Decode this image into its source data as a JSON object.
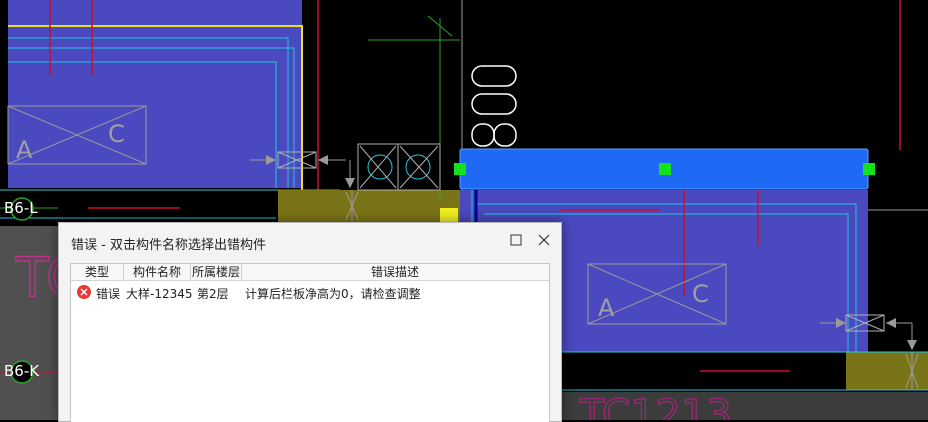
{
  "canvas": {
    "axis_labels": [
      "B6-L",
      "B6-K"
    ],
    "beam_text": [
      "A",
      "C"
    ],
    "colors": {
      "background": "#000000",
      "slab_fill": "#4a49c0",
      "selected_fill": "#1e6af5",
      "olive_fill": "#7a7418",
      "cyan_line": "#22c8dc",
      "red_line": "#c8102e",
      "grip": "#16e01a",
      "yellow_line": "#e8e020"
    }
  },
  "dialog": {
    "title": "错误 - 双击构件名称选择出错构件",
    "maximize_icon": "maximize-icon",
    "close_icon": "close-icon",
    "columns": [
      "类型",
      "构件名称",
      "所属楼层",
      "错误描述"
    ],
    "rows": [
      {
        "icon": "error-icon",
        "type": "错误",
        "name": "大样-12345",
        "floor": "第2层",
        "description": "计算后栏板净高为0，请检查调整"
      }
    ]
  }
}
